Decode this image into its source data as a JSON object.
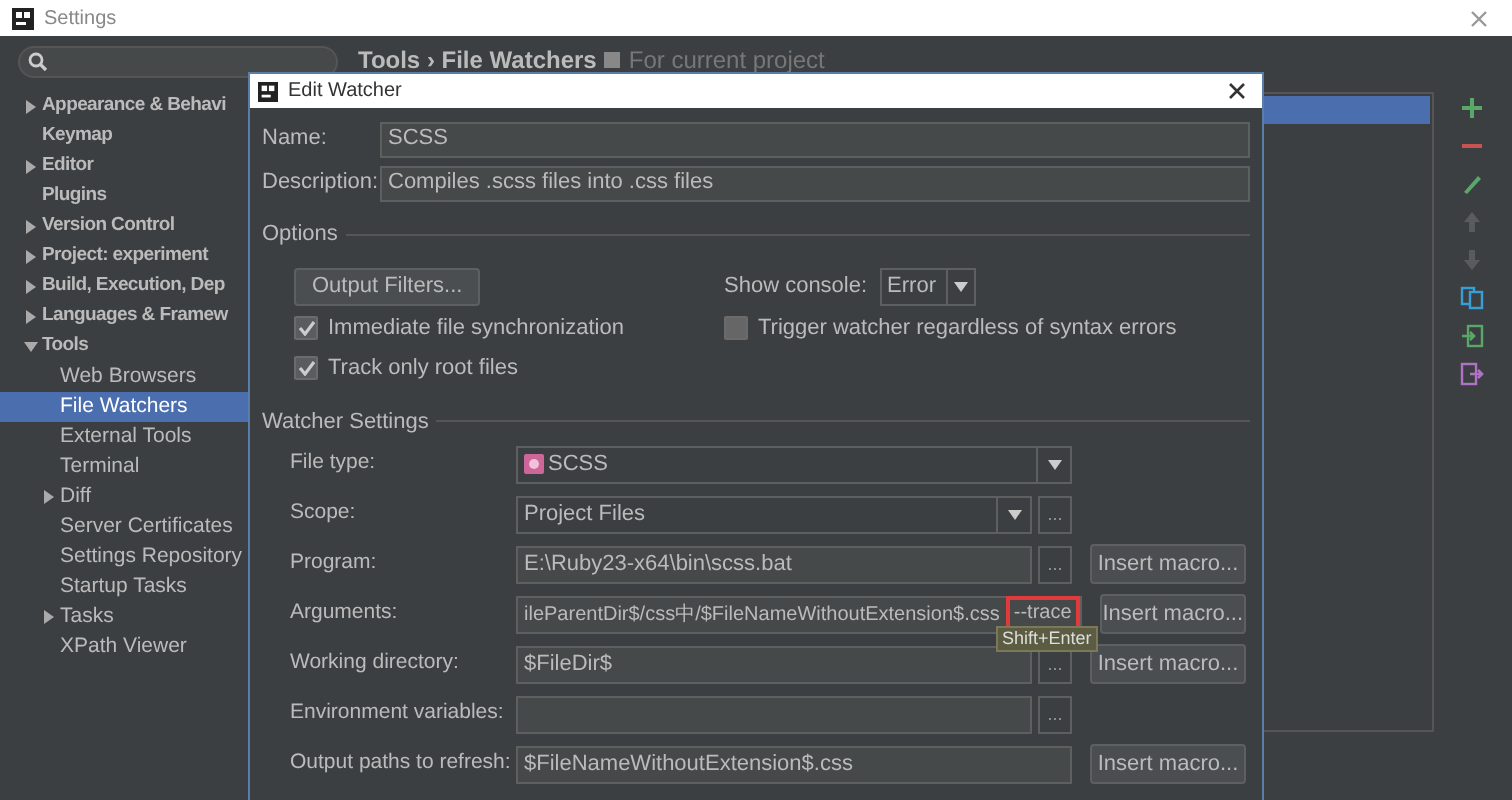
{
  "settings_window": {
    "title": "Settings"
  },
  "sidebar": {
    "items": [
      {
        "label": "Appearance & Behavi",
        "expanded": false,
        "selected": false
      },
      {
        "label": "Keymap",
        "selected": false
      },
      {
        "label": "Editor",
        "expanded": false,
        "selected": false
      },
      {
        "label": "Plugins",
        "selected": false
      },
      {
        "label": "Version Control",
        "expanded": false,
        "selected": false
      },
      {
        "label": "Project: experiment",
        "expanded": false,
        "selected": false
      },
      {
        "label": "Build, Execution, Dep",
        "expanded": false,
        "selected": false
      },
      {
        "label": "Languages & Framew",
        "expanded": false,
        "selected": false
      },
      {
        "label": "Tools",
        "expanded": true,
        "selected": false,
        "children": [
          {
            "label": "Web Browsers",
            "selected": false
          },
          {
            "label": "File Watchers",
            "selected": true
          },
          {
            "label": "External Tools",
            "selected": false
          },
          {
            "label": "Terminal",
            "selected": false
          },
          {
            "label": "Diff",
            "expanded": false,
            "selected": false
          },
          {
            "label": "Server Certificates",
            "selected": false
          },
          {
            "label": "Settings Repository",
            "selected": false
          },
          {
            "label": "Startup Tasks",
            "selected": false
          },
          {
            "label": "Tasks",
            "expanded": false,
            "selected": false
          },
          {
            "label": "XPath Viewer",
            "selected": false
          }
        ]
      }
    ]
  },
  "breadcrumb": {
    "title": "Tools › File Watchers",
    "scope": "For current project"
  },
  "watchers_list": {
    "rows": [
      {
        "selected": true
      }
    ]
  },
  "toolbar": [
    {
      "kind": "add",
      "disabled": false
    },
    {
      "kind": "remove",
      "disabled": false
    },
    {
      "kind": "edit",
      "disabled": false
    },
    {
      "kind": "up",
      "disabled": true
    },
    {
      "kind": "down",
      "disabled": true
    },
    {
      "kind": "copy",
      "disabled": false
    },
    {
      "kind": "import",
      "disabled": false
    },
    {
      "kind": "export",
      "disabled": false
    }
  ],
  "dialog": {
    "title": "Edit Watcher",
    "name": {
      "label": "Name:",
      "value": "SCSS"
    },
    "description": {
      "label": "Description:",
      "value": "Compiles .scss files into .css files"
    },
    "options": {
      "heading": "Options",
      "output_filters": "Output Filters...",
      "show_console": {
        "label": "Show console:",
        "value": "Error"
      },
      "checkboxes": [
        {
          "label": "Immediate file synchronization",
          "checked": true
        },
        {
          "label": "Trigger watcher regardless of syntax errors",
          "checked": false
        },
        {
          "label": "Track only root files",
          "checked": true
        }
      ]
    },
    "watcher_settings": {
      "heading": "Watcher Settings",
      "rows": [
        {
          "kind": "filetype",
          "label": "File type:",
          "value": "SCSS"
        },
        {
          "kind": "combo",
          "label": "Scope:",
          "value": "Project Files",
          "browse": "..."
        },
        {
          "kind": "text",
          "label": "Program:",
          "value": "E:\\Ruby23-x64\\bin\\scss.bat",
          "browse": "...",
          "macro": "Insert macro..."
        },
        {
          "kind": "text",
          "label": "Arguments:",
          "value": "ileParentDir$/css中/$FileNameWithoutExtension$.css",
          "marked": "--trace",
          "macro": "Insert macro..."
        },
        {
          "kind": "text",
          "label": "Working directory:",
          "value": "$FileDir$",
          "browse": "...",
          "macro": "Insert macro..."
        },
        {
          "kind": "text",
          "label": "Environment variables:",
          "browse": "..."
        },
        {
          "kind": "text",
          "label": "Output paths to refresh:",
          "value": "$FileNameWithoutExtension$.css",
          "macro": "Insert macro..."
        }
      ]
    },
    "tooltip": "Shift+Enter"
  }
}
